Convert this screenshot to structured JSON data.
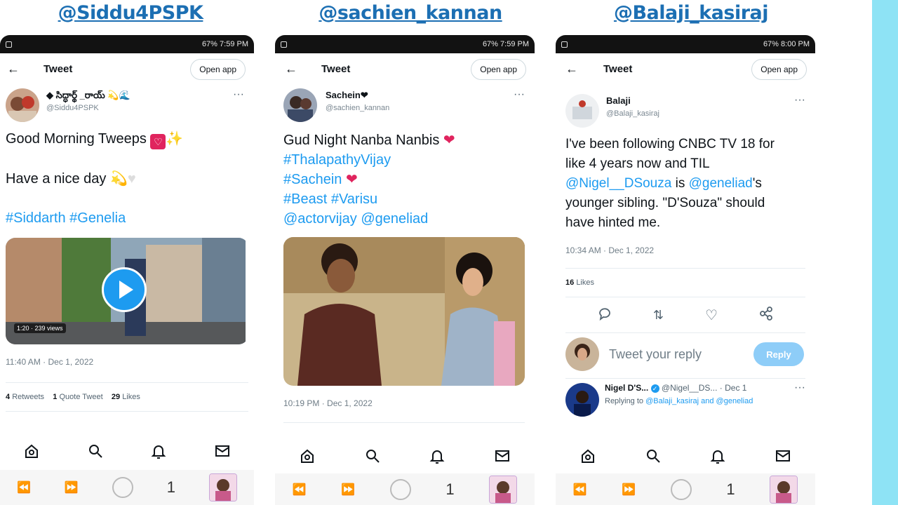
{
  "columns": [
    {
      "handle_title": "@Siddu4PSPK"
    },
    {
      "handle_title": "@sachien_kannan"
    },
    {
      "handle_title": "@Balaji_kasiraj"
    }
  ],
  "status": {
    "p1": {
      "signal": "67%",
      "time": "7:59 PM"
    },
    "p2": {
      "signal": "67%",
      "time": "7:59 PM"
    },
    "p3": {
      "signal": "67%",
      "time": "8:00 PM"
    }
  },
  "header": {
    "title": "Tweet",
    "open_app": "Open app"
  },
  "tweet1": {
    "name": "◆ సిద్ధార్థ్ _రాయ్ 💫🌊",
    "handle": "@Siddu4PSPK",
    "line1": "Good Morning Tweeps",
    "line2": "Have a nice day",
    "tags": "#Siddarth #Genelia",
    "video_length": "1:20",
    "video_views": "239 views",
    "timestamp": "11:40 AM · Dec 1, 2022",
    "retweets_count": "4",
    "retweets_label": "Retweets",
    "quotes_count": "1",
    "quotes_label": "Quote Tweet",
    "likes_count": "29",
    "likes_label": "Likes"
  },
  "tweet2": {
    "name": "Sachein❤",
    "handle": "@sachien_kannan",
    "line1": "Gud Night Nanba Nanbis",
    "line2": "#ThalapathyVijay",
    "line3": "#Sachein",
    "line4": "#Beast #Varisu",
    "line5": "@actorvijay @geneliad",
    "timestamp": "10:19 PM · Dec 1, 2022"
  },
  "tweet3": {
    "name": "Balaji",
    "handle": "@Balaji_kasiraj",
    "text_a": "I've been following CNBC TV 18 for like 4 years now and TIL",
    "mention1": "@Nigel__DSouza",
    "text_b": " is ",
    "mention2": "@geneliad",
    "text_c": "'s younger sibling. \"D'Souza\" should have hinted me.",
    "timestamp": "10:34 AM · Dec 1, 2022",
    "likes_count": "16",
    "likes_label": "Likes",
    "reply_placeholder": "Tweet your reply",
    "reply_button": "Reply",
    "reply_name": "Nigel D'S...",
    "reply_handle": "@Nigel__DS...",
    "reply_date": "· Dec 1",
    "replying_prefix": "Replying to",
    "replying_to": "@Balaji_kasiraj and @geneliad"
  },
  "browser": {
    "tab_count": "1"
  },
  "colors": {
    "accent": "#1d9bf0",
    "title_blue": "#1c6fb3",
    "strip": "#8ee3f5"
  }
}
